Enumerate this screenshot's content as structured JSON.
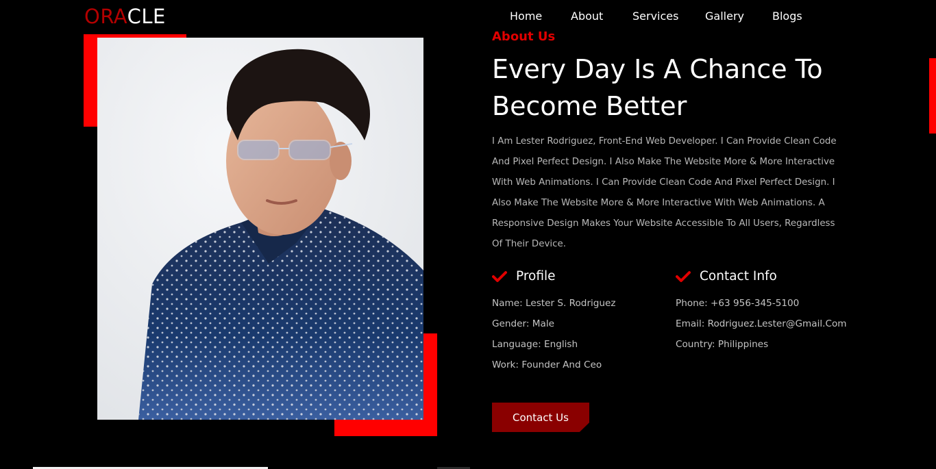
{
  "header": {
    "logo_part1": "ORA",
    "logo_part2": "CLE",
    "nav": [
      "Home",
      "About",
      "Services",
      "Gallery",
      "Blogs"
    ]
  },
  "about": {
    "eyebrow": "About Us",
    "headline": "Every Day Is A Chance To Become Better",
    "intro": "I Am Lester Rodriguez, Front-End Web Developer. I Can Provide Clean Code And Pixel Perfect Design. I Also Make The Website More & More Interactive With Web Animations. I Can Provide Clean Code And Pixel Perfect Design. I Also Make The Website More & More Interactive With Web Animations. A Responsive Design Makes Your Website Accessible To All Users, Regardless Of Their Device.",
    "profile": {
      "title": "Profile",
      "items": [
        "Name: Lester S. Rodriguez",
        "Gender: Male",
        "Language: English",
        "Work: Founder And Ceo"
      ]
    },
    "contact": {
      "title": "Contact Info",
      "items": [
        "Phone: +63 956-345-5100",
        "Email: Rodriguez.Lester@Gmail.Com",
        "Country: Philippines"
      ]
    },
    "button_label": "Contact Us"
  },
  "colors": {
    "accent": "#ff0000",
    "button": "#8a0000",
    "logo_red": "#b30000",
    "background": "#000000"
  }
}
